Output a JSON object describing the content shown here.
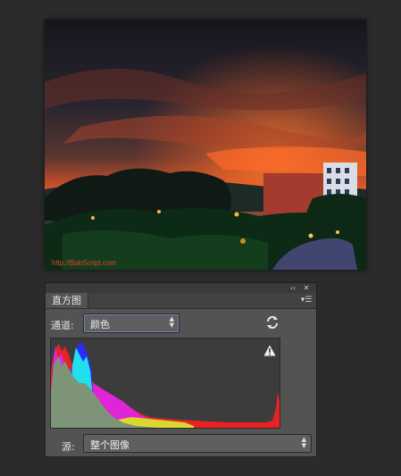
{
  "photo": {
    "watermark": "http://BobScript.com"
  },
  "panel": {
    "tab_label": "直方图",
    "collapse_icon": "double-chevron-left-icon",
    "close_icon": "close-icon",
    "menu_icon": "panel-menu-icon",
    "channel": {
      "label": "通道:",
      "value": "颜色"
    },
    "refresh_icon": "refresh-icon",
    "warning_icon": "warning-icon",
    "source": {
      "label": "源:",
      "value": "整个图像"
    }
  },
  "colors": {
    "panel_bg": "#535353",
    "app_bg": "#2b2b2b",
    "histogram_bg": "#3c3c3c",
    "accent_focus": "#6a86b6"
  }
}
